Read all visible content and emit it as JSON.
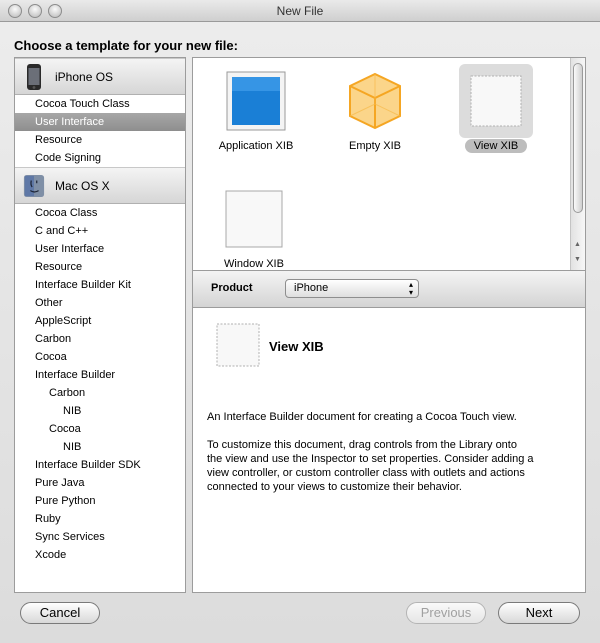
{
  "window": {
    "title": "New File"
  },
  "heading": "Choose a template for your new file:",
  "sidebar": {
    "groups": [
      {
        "label": "iPhone OS",
        "icon": "iphone-icon",
        "items": [
          {
            "label": "Cocoa Touch Class"
          },
          {
            "label": "User Interface",
            "selected": true
          },
          {
            "label": "Resource"
          },
          {
            "label": "Code Signing"
          }
        ]
      },
      {
        "label": "Mac OS X",
        "icon": "mac-os-x-icon",
        "items": [
          {
            "label": "Cocoa Class"
          },
          {
            "label": "C and C++"
          },
          {
            "label": "User Interface"
          },
          {
            "label": "Resource"
          },
          {
            "label": "Interface Builder Kit"
          },
          {
            "label": "Other"
          },
          {
            "label": "AppleScript"
          },
          {
            "label": "Carbon"
          },
          {
            "label": "Cocoa"
          },
          {
            "label": "Interface Builder"
          },
          {
            "label": "Carbon"
          },
          {
            "label": "NIB"
          },
          {
            "label": "Cocoa"
          },
          {
            "label": "NIB"
          },
          {
            "label": "Interface Builder SDK"
          },
          {
            "label": "Pure Java"
          },
          {
            "label": "Pure Python"
          },
          {
            "label": "Ruby"
          },
          {
            "label": "Sync Services"
          },
          {
            "label": "Xcode"
          }
        ]
      }
    ]
  },
  "templates": [
    {
      "label": "Application XIB",
      "icon": "application-xib-icon"
    },
    {
      "label": "Empty XIB",
      "icon": "empty-xib-icon"
    },
    {
      "label": "View XIB",
      "icon": "view-xib-icon",
      "selected": true
    },
    {
      "label": "Window XIB",
      "icon": "window-xib-icon"
    }
  ],
  "product": {
    "label": "Product",
    "value": "iPhone"
  },
  "description": {
    "title": "View XIB",
    "icon": "view-xib-icon",
    "summary": "An Interface Builder document for creating a Cocoa Touch view.",
    "detail_lines": [
      "To customize this document, drag controls from the Library onto",
      "the view and use the Inspector to set properties. Consider adding a",
      "view controller, or custom controller class with outlets and actions",
      "connected to your views to customize their behavior."
    ]
  },
  "buttons": {
    "cancel": "Cancel",
    "previous": "Previous",
    "next": "Next"
  },
  "colors": {
    "selection": "#9a9a9a",
    "app_xib_blue": "#1a7fd6",
    "empty_xib_orange": "#f5a623"
  }
}
